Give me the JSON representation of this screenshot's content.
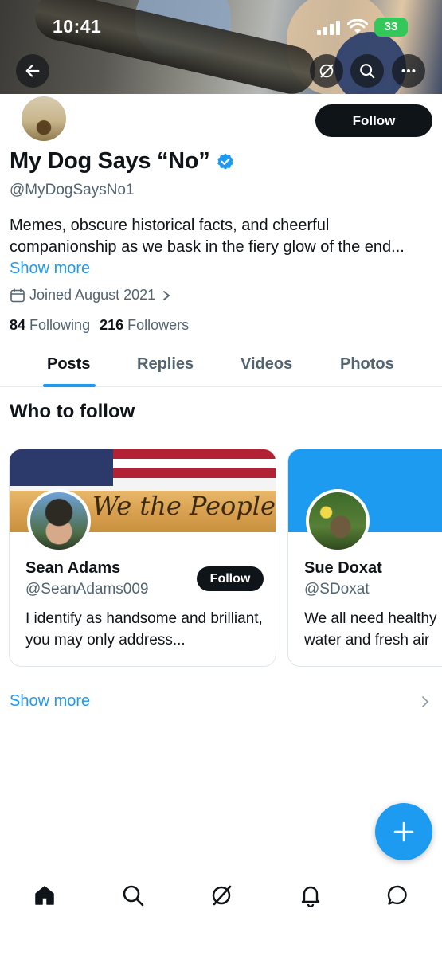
{
  "status_bar": {
    "time": "10:41",
    "battery": "33"
  },
  "header": {
    "back_icon": "arrow-left-icon",
    "grok_icon": "grok-icon",
    "search_icon": "search-icon",
    "more_icon": "more-icon"
  },
  "profile": {
    "name": "My Dog Says “No”",
    "handle": "@MyDogSaysNo1",
    "bio": "Memes, obscure historical facts, and cheerful companionship as we bask in the fiery glow of the end...",
    "show_more": "Show more",
    "joined": "Joined August 2021",
    "following_count": "84",
    "following_label": "Following",
    "followers_count": "216",
    "followers_label": "Followers",
    "follow_label": "Follow"
  },
  "tabs": [
    {
      "label": "Posts",
      "active": true
    },
    {
      "label": "Replies",
      "active": false
    },
    {
      "label": "Videos",
      "active": false
    },
    {
      "label": "Photos",
      "active": false
    }
  ],
  "who_to_follow": {
    "title": "Who to follow",
    "cards": [
      {
        "name": "Sean Adams",
        "handle": "@SeanAdams009",
        "bio": "I identify as handsome and brilliant, you may only address...",
        "follow_label": "Follow",
        "banner_text": "We the People"
      },
      {
        "name": "Sue Doxat",
        "handle": "@SDoxat",
        "bio": "We all need healthy",
        "bio2": "water and fresh air"
      }
    ],
    "show_more": "Show more"
  },
  "fab": {
    "icon": "plus-icon"
  },
  "bottom_nav": [
    {
      "icon": "home-icon"
    },
    {
      "icon": "search-icon"
    },
    {
      "icon": "grok-icon"
    },
    {
      "icon": "bell-icon"
    },
    {
      "icon": "messages-icon"
    }
  ],
  "colors": {
    "accent": "#1d9bf0",
    "text": "#0f1419",
    "muted": "#536471",
    "button": "#0f1419"
  }
}
